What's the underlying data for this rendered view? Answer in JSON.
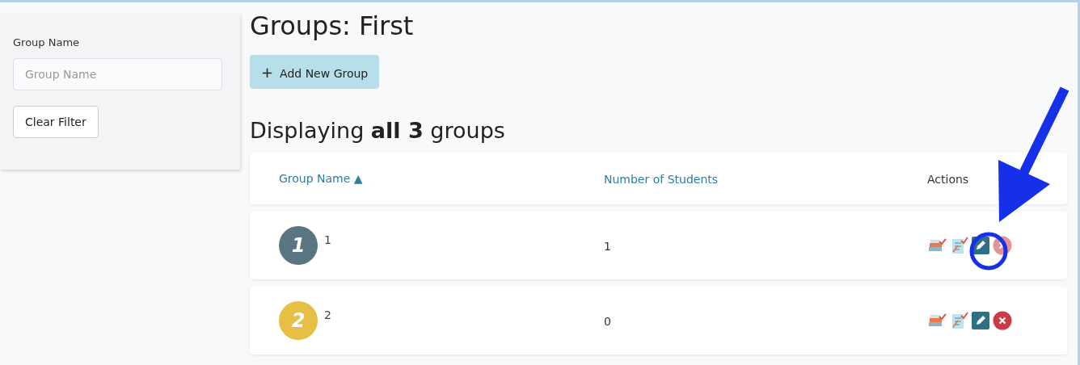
{
  "filter": {
    "label": "Group Name",
    "placeholder": "Group Name",
    "clear_button": "Clear Filter"
  },
  "title": "Groups: First",
  "add_button": {
    "icon": "+",
    "label": "Add New Group"
  },
  "summary": "Displaying **all 3** groups",
  "table": {
    "columns": [
      {
        "label": "Group Name",
        "sort": "▲"
      },
      {
        "label": "Number of Students"
      },
      {
        "label": "Actions"
      }
    ],
    "rows": [
      {
        "badge": "1",
        "color": "#5a7582",
        "name": "1",
        "students": "1",
        "delete_disabled": true
      },
      {
        "badge": "2",
        "color": "#e8bf45",
        "name": "2",
        "students": "0",
        "delete_disabled": false
      }
    ]
  },
  "annotation": {
    "kind": "arrow-circle"
  }
}
